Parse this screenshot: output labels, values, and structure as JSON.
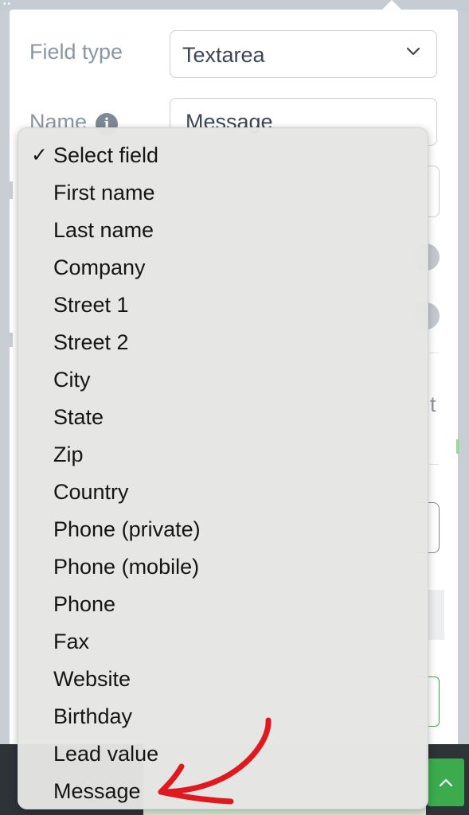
{
  "form": {
    "field_type_label": "Field type",
    "field_type_value": "Textarea",
    "name_label": "Name",
    "name_value": "Message",
    "peek_letter": "t"
  },
  "dropdown": {
    "selected_index": 0,
    "options": [
      "Select field",
      "First name",
      "Last name",
      "Company",
      "Street 1",
      "Street 2",
      "City",
      "State",
      "Zip",
      "Country",
      "Phone (private)",
      "Phone (mobile)",
      "Phone",
      "Fax",
      "Website",
      "Birthday",
      "Lead value",
      "Message"
    ]
  },
  "icons": {
    "info": "info-icon",
    "chevron": "chevron-down-icon",
    "check": "checkmark-icon",
    "scroll_up": "chevron-up-icon",
    "annotation": "red-arrow-annotation"
  },
  "colors": {
    "accent_green": "#3bab4e",
    "annotation_red": "#e0191e",
    "label_gray": "#8a96a3"
  }
}
